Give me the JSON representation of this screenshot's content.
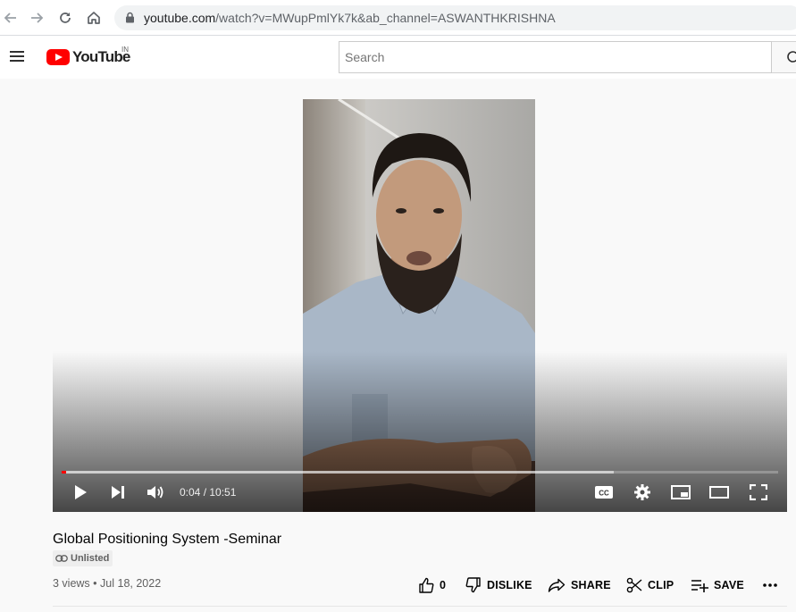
{
  "browser": {
    "url_host": "youtube.com",
    "url_rest": "/watch?v=MWupPmlYk7k&ab_channel=ASWANTHKRISHNA",
    "back_icon": "arrow-left-icon",
    "forward_icon": "arrow-right-icon",
    "reload_icon": "reload-icon",
    "home_icon": "home-icon"
  },
  "masthead": {
    "logo_text": "YouTube",
    "country_code": "IN",
    "search_placeholder": "Search",
    "search_value": ""
  },
  "player": {
    "current_time": "0:04",
    "separator": " / ",
    "duration": "10:51",
    "progress_played_fraction": 0.006,
    "progress_loaded_fraction": 0.77,
    "accent_color": "#ff0000"
  },
  "video": {
    "title": "Global Positioning System -Seminar",
    "privacy_badge": "Unlisted",
    "views": "3 views",
    "dot": "•",
    "date": "Jul 18, 2022"
  },
  "actions": {
    "like_count": "0",
    "dislike_label": "DISLIKE",
    "share_label": "SHARE",
    "clip_label": "CLIP",
    "save_label": "SAVE"
  }
}
